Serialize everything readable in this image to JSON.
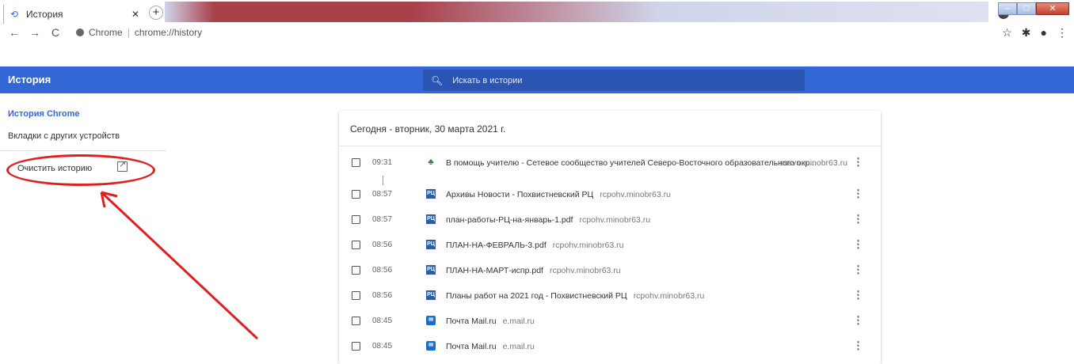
{
  "browser": {
    "tab_title": "История",
    "url_site": "Chrome",
    "url_path": "chrome://history"
  },
  "header": {
    "title": "История",
    "search_placeholder": "Искать в истории"
  },
  "sidebar": {
    "items": [
      {
        "label": "История Chrome",
        "active": true
      },
      {
        "label": "Вкладки с других устройств",
        "active": false
      }
    ],
    "clear_label": "Очистить историю"
  },
  "history": {
    "date_heading": "Сегодня - вторник, 30 марта 2021 г.",
    "entries": [
      {
        "time": "09:31",
        "title": "В помощь учителю - Сетевое сообщество учителей Северо-Восточного образовательного окр...",
        "domain": "sssvu.minobr63.ru",
        "favicon": "edu"
      },
      {
        "time": "08:57",
        "title": "Архивы Новости - Похвистневский РЦ",
        "domain": "rcpohv.minobr63.ru",
        "favicon": "pu"
      },
      {
        "time": "08:57",
        "title": "план-работы-РЦ-на-январь-1.pdf",
        "domain": "rcpohv.minobr63.ru",
        "favicon": "pu"
      },
      {
        "time": "08:56",
        "title": "ПЛАН-НА-ФЕВРАЛЬ-3.pdf",
        "domain": "rcpohv.minobr63.ru",
        "favicon": "pu"
      },
      {
        "time": "08:56",
        "title": "ПЛАН-НА-МАРТ-испр.pdf",
        "domain": "rcpohv.minobr63.ru",
        "favicon": "pu"
      },
      {
        "time": "08:56",
        "title": "Планы работ на 2021 год - Похвистневский РЦ",
        "domain": "rcpohv.minobr63.ru",
        "favicon": "pu"
      },
      {
        "time": "08:45",
        "title": "Почта Mail.ru",
        "domain": "e.mail.ru",
        "favicon": "mail"
      },
      {
        "time": "08:45",
        "title": "Почта Mail.ru",
        "domain": "e.mail.ru",
        "favicon": "mail"
      }
    ]
  },
  "colors": {
    "header_blue": "#3367d6",
    "annotation_red": "#e02020"
  }
}
